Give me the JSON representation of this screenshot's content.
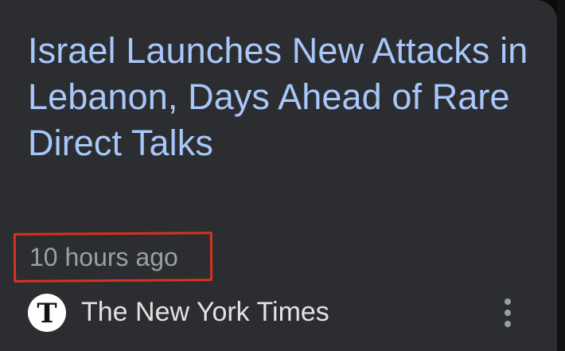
{
  "article": {
    "headline": "Israel Launches New Attacks in Lebanon, Days Ahead of Rare Direct Talks",
    "timestamp": "10 hours ago",
    "source": {
      "name": "The New York Times",
      "logo_letter": "T",
      "logo_icon": "nyt-logo-icon"
    },
    "menu_icon": "more-vert-icon"
  },
  "colors": {
    "card_background": "#2c2d30",
    "headline": "#a8c7fa",
    "timestamp": "#9aa0a6",
    "source_text": "#e3e3e3",
    "highlight_box": "#d8321f"
  }
}
